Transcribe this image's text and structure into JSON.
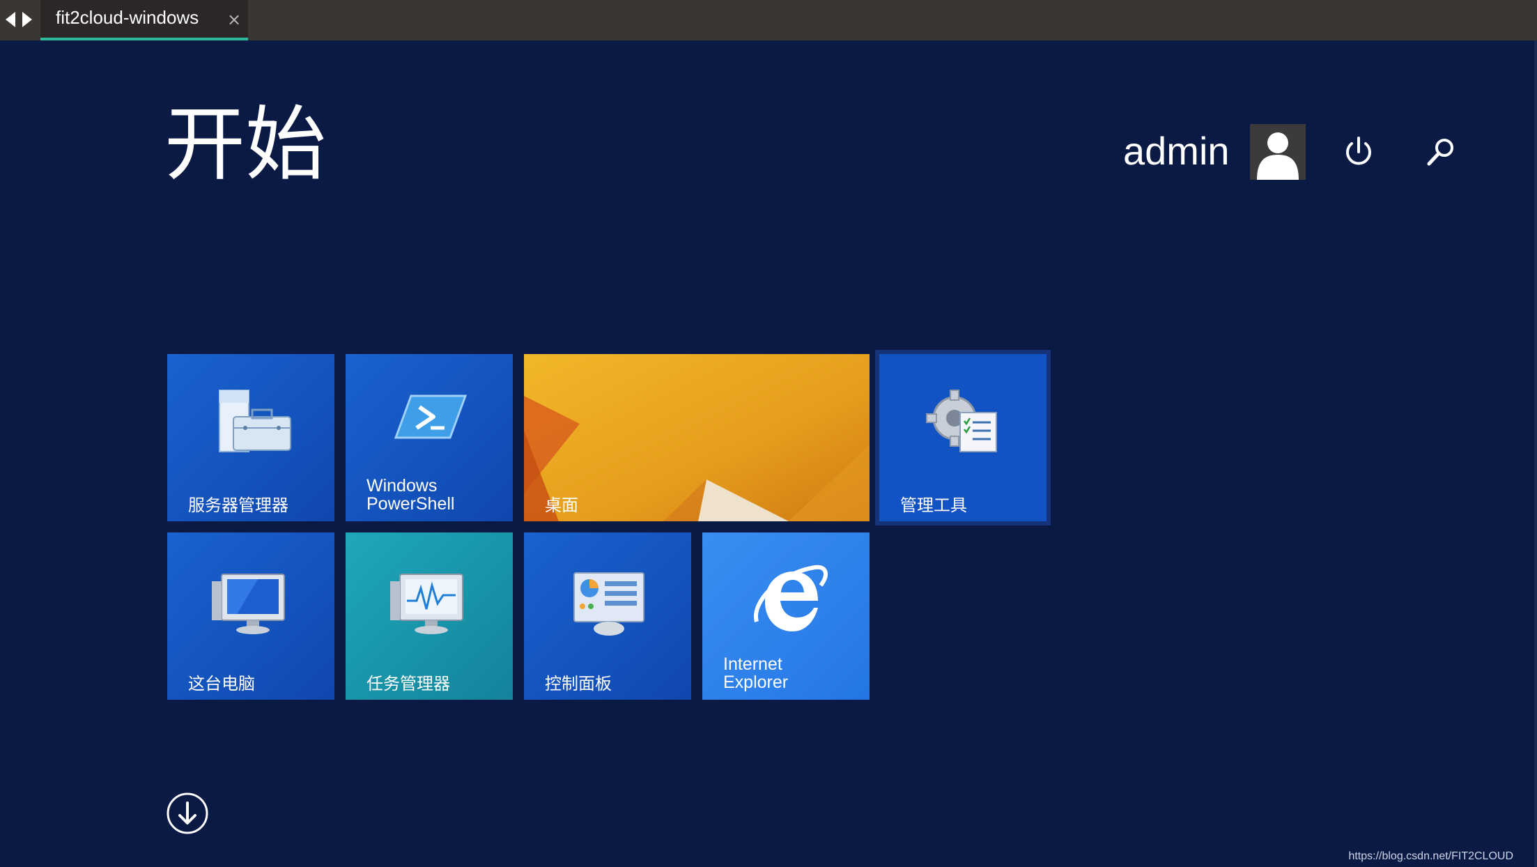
{
  "browser": {
    "tab_title": "fit2cloud-windows",
    "close_glyph": "×"
  },
  "start": {
    "title": "开始",
    "username": "admin"
  },
  "tiles": [
    {
      "label": "服务器管理器",
      "icon": "server-manager-icon"
    },
    {
      "label_line1": "Windows",
      "label_line2": "PowerShell",
      "icon": "powershell-icon"
    },
    {
      "label": "桌面",
      "icon": "desktop-wallpaper"
    },
    {
      "label": "管理工具",
      "icon": "admin-tools-icon"
    },
    {
      "label": "这台电脑",
      "icon": "computer-icon"
    },
    {
      "label": "任务管理器",
      "icon": "task-manager-icon"
    },
    {
      "label": "控制面板",
      "icon": "control-panel-icon"
    },
    {
      "label_line1": "Internet",
      "label_line2": "Explorer",
      "icon": "ie-icon"
    }
  ],
  "footer": {
    "url": "https://blog.csdn.net/FIT2CLOUD"
  },
  "colors": {
    "background": "#0b1a45",
    "tile_blue": "#1253c4",
    "tile_teal": "#1a9db1",
    "tile_ie": "#2f82ec",
    "tab_accent": "#2fb89a"
  }
}
